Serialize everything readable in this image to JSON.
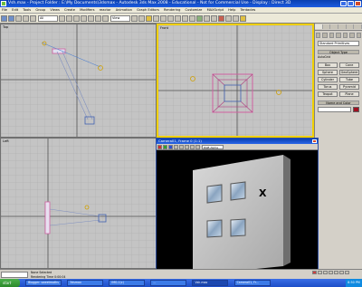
{
  "title_bar": {
    "text": "Vsh.max    -    Project Folder : E:\\My Documents\\3dsmax    -    Autodesk 3ds Max 2008    -    Educational - Not for Commercial Use    -    Display : Direct 3D"
  },
  "menu": [
    "File",
    "Edit",
    "Tools",
    "Group",
    "Views",
    "Create",
    "Modifiers",
    "reactor",
    "Animation",
    "Graph Editors",
    "Rendering",
    "Customize",
    "MAXScript",
    "Help",
    "Tentacles"
  ],
  "toolbar": {
    "selection_filter": "All",
    "reference_coord": "View"
  },
  "viewports": {
    "top": {
      "label": "Top"
    },
    "front": {
      "label": "Front"
    },
    "left": {
      "label": "Left"
    }
  },
  "command_panel": {
    "category": "Standard Primitives",
    "object_type_title": "Object Type",
    "autogrid": "AutoGrid",
    "buttons": [
      "Box",
      "Cone",
      "Sphere",
      "GeoSphere",
      "Cylinder",
      "Tube",
      "Torus",
      "Pyramid",
      "Teapot",
      "Plane"
    ],
    "name_color_title": "Name and Color"
  },
  "render_window": {
    "title": "Camera01, Frame 0 (1:1)",
    "channel": "RGB Alpha",
    "marker": "X"
  },
  "status": {
    "line1": "None Selected",
    "line2": "Rendering Time 0:00:04"
  },
  "taskbar": {
    "start": "start",
    "tasks": [
      "Blogger: sweetmaths",
      "3dsmax",
      "IMG-1(c)",
      "...",
      "Vsh.max",
      "Camera01, Fr..."
    ],
    "clock": "8:50 PM"
  }
}
